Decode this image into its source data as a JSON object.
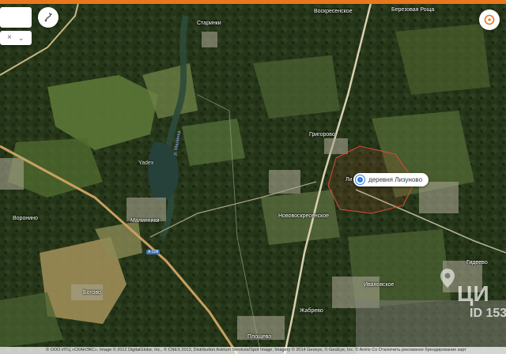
{
  "map": {
    "search_value": "",
    "clear_icon": "×",
    "dropdown_icon": "⌄",
    "route_icon": "route-icon",
    "compass_icon": "compass-icon",
    "road_label": "A-108",
    "river_label": "р. Малинка",
    "places": [
      {
        "id": "starinki",
        "label": "Старинки"
      },
      {
        "id": "voskresenskoe",
        "label": "Воскресенское"
      },
      {
        "id": "berezovaya",
        "label": "Березовая Роща"
      },
      {
        "id": "grigorovo",
        "label": "Григорово"
      },
      {
        "id": "novovoskresenskoe",
        "label": "Нововоскресенское"
      },
      {
        "id": "voronino",
        "label": "Воронино"
      },
      {
        "id": "malinniki",
        "label": "Малинники"
      },
      {
        "id": "botovo",
        "label": "Ботово"
      },
      {
        "id": "ploschevo",
        "label": "Площево"
      },
      {
        "id": "zhabrevo",
        "label": "Жабрево"
      },
      {
        "id": "ivanovskoe",
        "label": "Ивановское"
      },
      {
        "id": "gideevo",
        "label": "Гидеево"
      },
      {
        "id": "liz",
        "label": "Ли"
      },
      {
        "id": "yandex",
        "label": "Yadex"
      }
    ],
    "selected_place": "деревня Лизуново",
    "watermark_brand": "ЦИ",
    "watermark_id": "ID 153",
    "attribution": "© ООО ИТЦ «СКАНЭКС», Image © 2012 DigitalGlobe, Inc., © CNES 2013, Distribution Astrium Services/Spot Image, Imagery © 2014 Geoeye, © GeoEye, Inc. © Antrix Со Отключить рекламное брендирование карт"
  },
  "colors": {
    "accent": "#e8771e",
    "pin": "#2b7ce8",
    "boundary": "#d94a3a"
  }
}
